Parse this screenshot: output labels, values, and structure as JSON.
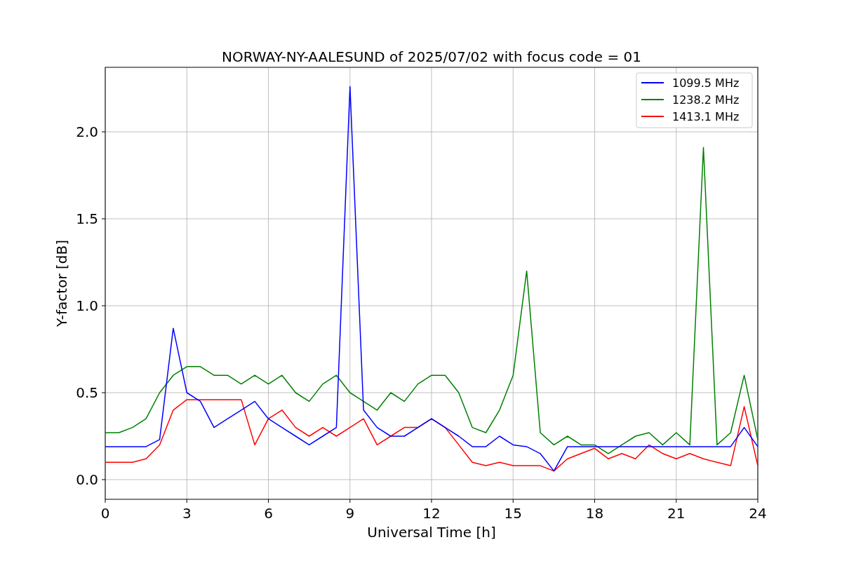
{
  "chart_data": {
    "type": "line",
    "title": "NORWAY-NY-AALESUND of 2025/07/02 with focus code = 01",
    "xlabel": "Universal Time [h]",
    "ylabel": "Y-factor [dB]",
    "x": [
      0,
      0.5,
      1,
      1.5,
      2,
      2.5,
      3,
      3.5,
      4,
      4.5,
      5,
      5.5,
      6,
      6.5,
      7,
      7.5,
      8,
      8.5,
      9,
      9.5,
      10,
      10.5,
      11,
      11.5,
      12,
      12.5,
      13,
      13.5,
      14,
      14.5,
      15,
      15.5,
      16,
      16.5,
      17,
      17.5,
      18,
      18.5,
      19,
      19.5,
      20,
      20.5,
      21,
      21.5,
      22,
      22.5,
      23,
      23.5,
      24
    ],
    "series": [
      {
        "name": "1099.5 MHz",
        "color": "#0000ff",
        "values": [
          0.19,
          0.19,
          0.19,
          0.19,
          0.23,
          0.87,
          0.5,
          0.45,
          0.3,
          0.35,
          0.4,
          0.45,
          0.35,
          0.3,
          0.25,
          0.2,
          0.25,
          0.3,
          2.26,
          0.4,
          0.3,
          0.25,
          0.25,
          0.3,
          0.35,
          0.3,
          0.25,
          0.19,
          0.19,
          0.25,
          0.2,
          0.19,
          0.15,
          0.05,
          0.19,
          0.19,
          0.19,
          0.19,
          0.19,
          0.19,
          0.19,
          0.19,
          0.19,
          0.19,
          0.19,
          0.19,
          0.19,
          0.3,
          0.19
        ]
      },
      {
        "name": "1238.2 MHz",
        "color": "#008000",
        "values": [
          0.27,
          0.27,
          0.3,
          0.35,
          0.5,
          0.6,
          0.65,
          0.65,
          0.6,
          0.6,
          0.55,
          0.6,
          0.55,
          0.6,
          0.5,
          0.45,
          0.55,
          0.6,
          0.5,
          0.45,
          0.4,
          0.5,
          0.45,
          0.55,
          0.6,
          0.6,
          0.5,
          0.3,
          0.27,
          0.4,
          0.6,
          1.2,
          0.27,
          0.2,
          0.25,
          0.2,
          0.2,
          0.15,
          0.2,
          0.25,
          0.27,
          0.2,
          0.27,
          0.2,
          1.91,
          0.2,
          0.27,
          0.6,
          0.23
        ]
      },
      {
        "name": "1413.1 MHz",
        "color": "#ff0000",
        "values": [
          0.1,
          0.1,
          0.1,
          0.12,
          0.2,
          0.4,
          0.46,
          0.46,
          0.46,
          0.46,
          0.46,
          0.2,
          0.35,
          0.4,
          0.3,
          0.25,
          0.3,
          0.25,
          0.3,
          0.35,
          0.2,
          0.25,
          0.3,
          0.3,
          0.35,
          0.3,
          0.2,
          0.1,
          0.08,
          0.1,
          0.08,
          0.08,
          0.08,
          0.05,
          0.12,
          0.15,
          0.18,
          0.12,
          0.15,
          0.12,
          0.2,
          0.15,
          0.12,
          0.15,
          0.12,
          0.1,
          0.08,
          0.42,
          0.08
        ]
      }
    ],
    "grid": true,
    "legend": true,
    "xlim": [
      0,
      24
    ],
    "ylim": [
      -0.113,
      2.371
    ],
    "xticks": [
      0,
      3,
      6,
      9,
      12,
      15,
      18,
      21,
      24
    ],
    "yticks": [
      {
        "value": 0,
        "label": "0.0"
      },
      {
        "value": 0.5,
        "label": "0.5"
      },
      {
        "value": 1,
        "label": "1.0"
      },
      {
        "value": 1.5,
        "label": "1.5"
      },
      {
        "value": 2,
        "label": "2.0"
      }
    ]
  }
}
